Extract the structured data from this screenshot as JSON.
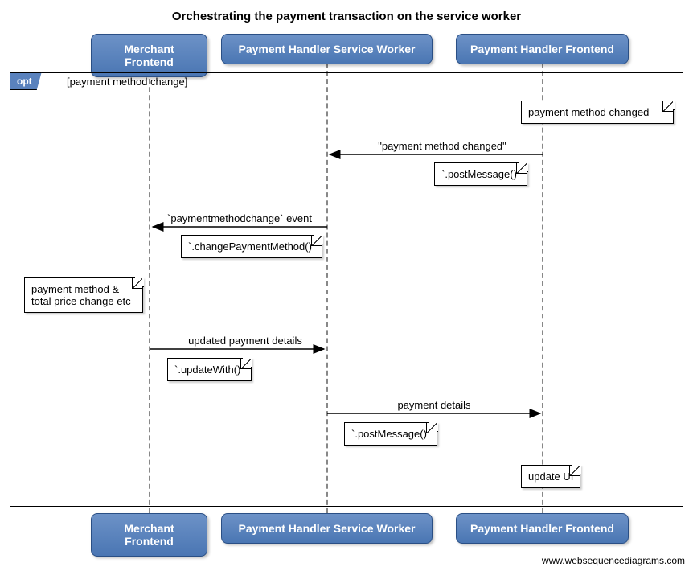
{
  "title": "Orchestrating the payment transaction on the service worker",
  "participants": {
    "p1": "Merchant Frontend",
    "p2": "Payment Handler Service Worker",
    "p3": "Payment Handler Frontend"
  },
  "frame": {
    "tag": "opt",
    "guard": "[payment method change]"
  },
  "notes": {
    "n1": "payment method changed",
    "n2": "`.postMessage()`",
    "n3": "`.changePaymentMethod()`",
    "n4": "payment method & total price change etc",
    "n5": "`.updateWith()`",
    "n6": "`.postMessage()`",
    "n7": "update UI"
  },
  "messages": {
    "m1": "\"payment method changed\"",
    "m2": "`paymentmethodchange` event",
    "m3": "updated payment details",
    "m4": "payment details"
  },
  "watermark": "www.websequencediagrams.com",
  "chart_data": {
    "type": "sequence-diagram",
    "title": "Orchestrating the payment transaction on the service worker",
    "participants": [
      "Merchant Frontend",
      "Payment Handler Service Worker",
      "Payment Handler Frontend"
    ],
    "fragments": [
      {
        "type": "opt",
        "guard": "payment method change",
        "steps": [
          {
            "type": "note",
            "over": "Payment Handler Frontend",
            "text": "payment method changed"
          },
          {
            "type": "message",
            "from": "Payment Handler Frontend",
            "to": "Payment Handler Service Worker",
            "label": "\"payment method changed\"",
            "caption": ".postMessage()"
          },
          {
            "type": "message",
            "from": "Payment Handler Service Worker",
            "to": "Merchant Frontend",
            "label": "`paymentmethodchange` event",
            "caption": ".changePaymentMethod()"
          },
          {
            "type": "note",
            "over": "Merchant Frontend",
            "text": "payment method & total price change etc"
          },
          {
            "type": "message",
            "from": "Merchant Frontend",
            "to": "Payment Handler Service Worker",
            "label": "updated payment details",
            "caption": ".updateWith()"
          },
          {
            "type": "message",
            "from": "Payment Handler Service Worker",
            "to": "Payment Handler Frontend",
            "label": "payment details",
            "caption": ".postMessage()"
          },
          {
            "type": "note",
            "over": "Payment Handler Frontend",
            "text": "update UI"
          }
        ]
      }
    ]
  }
}
